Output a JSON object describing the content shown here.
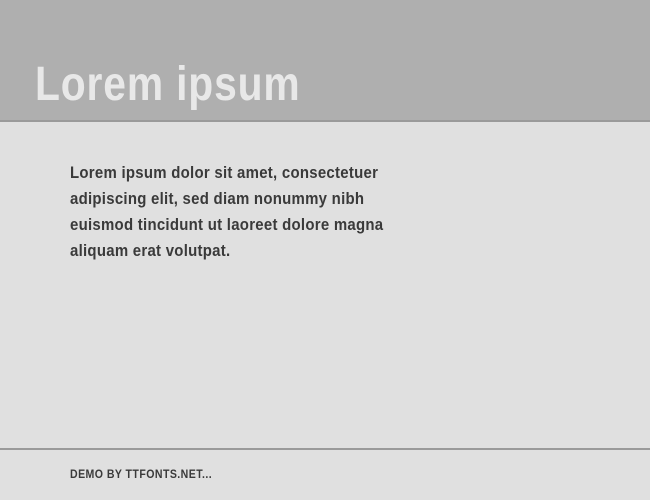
{
  "header": {
    "title": "Lorem ipsum"
  },
  "content": {
    "body": "Lorem ipsum dolor sit amet, consectetuer adipiscing elit, sed diam nonummy nibh euismod tincidunt ut laoreet dolore magna aliquam erat volutpat."
  },
  "footer": {
    "text": "DEMO BY TTFONTS.NET..."
  }
}
